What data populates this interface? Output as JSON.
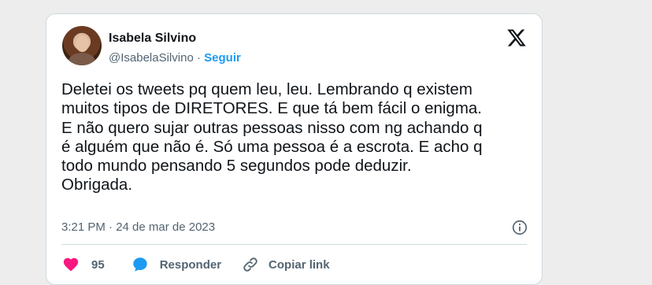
{
  "author": {
    "name": "Isabela Silvino",
    "handle": "@IsabelaSilvino",
    "separator": " · ",
    "follow_label": "Seguir"
  },
  "tweet": {
    "text": "Deletei os tweets pq quem leu, leu. Lembrando q existem\nmuitos tipos de DIRETORES. E que tá bem fácil o enigma.\nE não quero sujar outras pessoas nisso com ng achando q\né alguém que não é. Só uma pessoa é a escrota. E acho q\ntodo mundo pensando 5 segundos pode deduzir.\nObrigada.",
    "timestamp": "3:21 PM · 24 de mar de 2023"
  },
  "actions": {
    "like_count": "95",
    "reply_label": "Responder",
    "copy_link_label": "Copiar link"
  },
  "icons": {
    "platform": "x-logo-icon",
    "info": "info-icon",
    "like": "heart-icon",
    "reply": "speech-bubble-icon",
    "copy": "link-icon"
  },
  "colors": {
    "accent": "#1d9bf0",
    "like": "#f91880",
    "text": "#0f1419",
    "muted": "#536471"
  }
}
